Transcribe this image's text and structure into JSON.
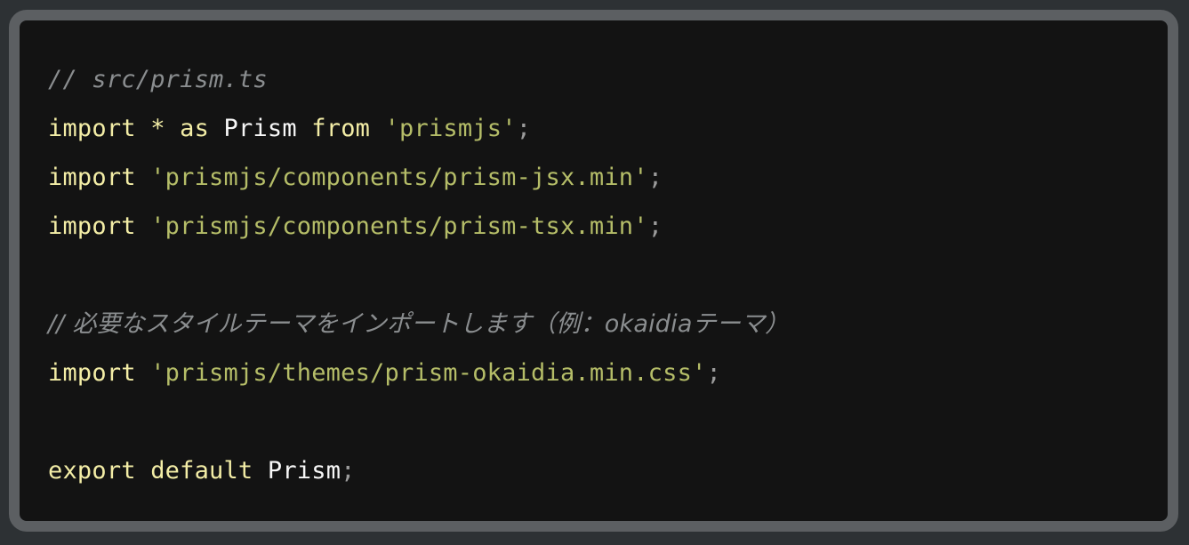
{
  "window": {
    "title": "src/prism.ts code snippet",
    "background_color": "#2d3134",
    "frame_border_color": "#5c5f62",
    "code_background_color": "#131313"
  },
  "theme": {
    "name": "okaidia-like dark",
    "comment_color": "#8a8d8f",
    "keyword_color": "#f3eda6",
    "string_color": "#b5bd68",
    "identifier_color": "#f7f7f7",
    "punctuation_color": "#9b9b9b"
  },
  "code": {
    "language": "typescript",
    "file_path": "src/prism.ts",
    "lines": [
      {
        "index": 1,
        "text": "// src/prism.ts",
        "tokens": [
          {
            "t": "// src/prism.ts",
            "k": "comment"
          }
        ]
      },
      {
        "index": 2,
        "text": "import * as Prism from 'prismjs';",
        "tokens": [
          {
            "t": "import",
            "k": "keyword"
          },
          {
            "t": " ",
            "k": "plain"
          },
          {
            "t": "*",
            "k": "operator"
          },
          {
            "t": " ",
            "k": "plain"
          },
          {
            "t": "as",
            "k": "keyword"
          },
          {
            "t": " ",
            "k": "plain"
          },
          {
            "t": "Prism",
            "k": "ident"
          },
          {
            "t": " ",
            "k": "plain"
          },
          {
            "t": "from",
            "k": "keyword"
          },
          {
            "t": " ",
            "k": "plain"
          },
          {
            "t": "'prismjs'",
            "k": "string"
          },
          {
            "t": ";",
            "k": "punct"
          }
        ]
      },
      {
        "index": 3,
        "text": "import 'prismjs/components/prism-jsx.min';",
        "tokens": [
          {
            "t": "import",
            "k": "keyword"
          },
          {
            "t": " ",
            "k": "plain"
          },
          {
            "t": "'prismjs/components/prism-jsx.min'",
            "k": "string"
          },
          {
            "t": ";",
            "k": "punct"
          }
        ]
      },
      {
        "index": 4,
        "text": "import 'prismjs/components/prism-tsx.min';",
        "tokens": [
          {
            "t": "import",
            "k": "keyword"
          },
          {
            "t": " ",
            "k": "plain"
          },
          {
            "t": "'prismjs/components/prism-tsx.min'",
            "k": "string"
          },
          {
            "t": ";",
            "k": "punct"
          }
        ]
      },
      {
        "index": 5,
        "text": "",
        "tokens": []
      },
      {
        "index": 6,
        "text": "// 必要なスタイルテーマをインポートします（例：okaidiaテーマ）",
        "tokens": [
          {
            "t": "// 必要なスタイルテーマをインポートします（例：okaidiaテーマ）",
            "k": "comment",
            "cjk": true
          }
        ]
      },
      {
        "index": 7,
        "text": "import 'prismjs/themes/prism-okaidia.min.css';",
        "tokens": [
          {
            "t": "import",
            "k": "keyword"
          },
          {
            "t": " ",
            "k": "plain"
          },
          {
            "t": "'prismjs/themes/prism-okaidia.min.css'",
            "k": "string"
          },
          {
            "t": ";",
            "k": "punct"
          }
        ]
      },
      {
        "index": 8,
        "text": "",
        "tokens": []
      },
      {
        "index": 9,
        "text": "export default Prism;",
        "tokens": [
          {
            "t": "export",
            "k": "keyword"
          },
          {
            "t": " ",
            "k": "plain"
          },
          {
            "t": "default",
            "k": "keyword"
          },
          {
            "t": " ",
            "k": "plain"
          },
          {
            "t": "Prism",
            "k": "ident"
          },
          {
            "t": ";",
            "k": "punct"
          }
        ]
      }
    ]
  }
}
